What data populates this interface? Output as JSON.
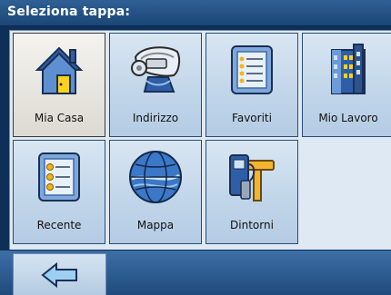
{
  "header": {
    "title": "Seleziona tappa:"
  },
  "tiles": [
    {
      "label": "Mia Casa",
      "icon": "home-icon"
    },
    {
      "label": "Indirizzo",
      "icon": "address-roadsign-icon"
    },
    {
      "label": "Favoriti",
      "icon": "favorites-list-icon"
    },
    {
      "label": "Mio Lavoro",
      "icon": "office-building-icon"
    },
    {
      "label": "Recente",
      "icon": "recent-list-icon"
    },
    {
      "label": "Mappa",
      "icon": "globe-map-icon"
    },
    {
      "label": "Dintorni",
      "icon": "fuel-pump-icon"
    }
  ],
  "footer": {
    "back_icon": "back-arrow-icon"
  },
  "colors": {
    "header": "#1b4677",
    "tile": "#c2d6ea",
    "selected_tile": "#eeeee9",
    "footer": "#2a5a8d"
  }
}
